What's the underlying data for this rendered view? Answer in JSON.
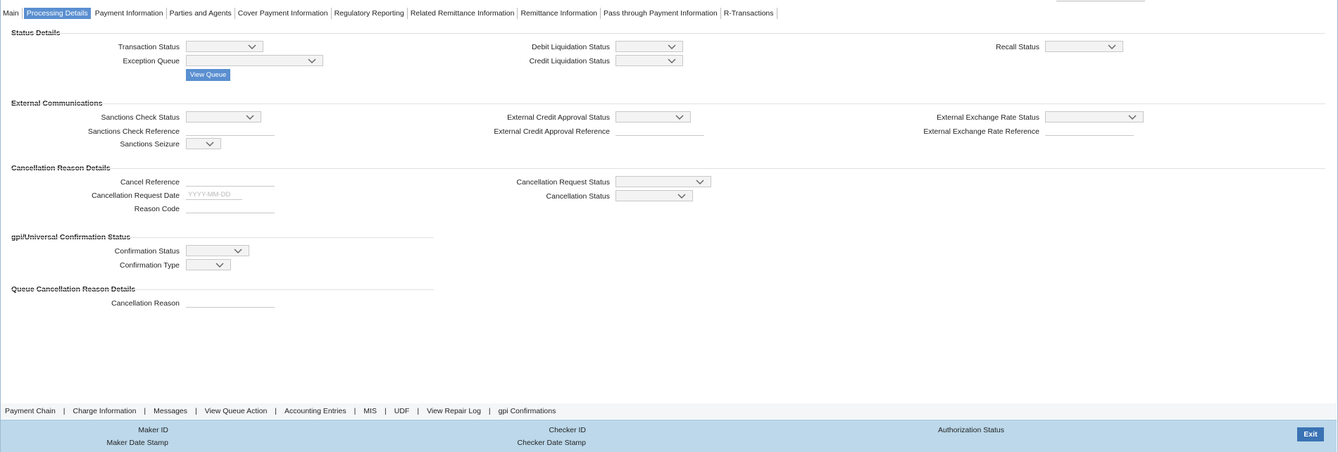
{
  "tabs": [
    {
      "label": "Main"
    },
    {
      "label": "Processing Details",
      "active": true
    },
    {
      "label": "Payment Information"
    },
    {
      "label": "Parties and Agents"
    },
    {
      "label": "Cover Payment Information"
    },
    {
      "label": "Regulatory Reporting"
    },
    {
      "label": "Related Remittance Information"
    },
    {
      "label": "Remittance Information"
    },
    {
      "label": "Pass through Payment Information"
    },
    {
      "label": "R-Transactions"
    }
  ],
  "status_details": {
    "title": "Status Details",
    "transaction_status": "Transaction Status",
    "exception_queue": "Exception Queue",
    "view_queue": "View Queue",
    "debit_liquidation_status": "Debit Liquidation Status",
    "credit_liquidation_status": "Credit Liquidation Status",
    "recall_status": "Recall Status"
  },
  "external_communications": {
    "title": "External Communications",
    "sanctions_check_status": "Sanctions Check Status",
    "sanctions_check_reference": "Sanctions Check Reference",
    "sanctions_seizure": "Sanctions Seizure",
    "external_credit_approval_status": "External Credit Approval Status",
    "external_credit_approval_reference": "External Credit Approval Reference",
    "external_exchange_rate_status": "External Exchange Rate Status",
    "external_exchange_rate_reference": "External Exchange Rate Reference"
  },
  "cancellation_reason_details": {
    "title": "Cancellation Reason Details",
    "cancel_reference": "Cancel Reference",
    "cancellation_request_date": "Cancellation Request Date",
    "date_placeholder": "YYYY-MM-DD",
    "reason_code": "Reason Code",
    "cancellation_request_status": "Cancellation Request Status",
    "cancellation_status": "Cancellation Status"
  },
  "gpi_confirmation": {
    "title": "gpi/Universal Confirmation Status",
    "confirmation_status": "Confirmation Status",
    "confirmation_type": "Confirmation Type"
  },
  "queue_cancellation": {
    "title": "Queue Cancellation Reason Details",
    "cancellation_reason": "Cancellation Reason"
  },
  "bottom_links": [
    {
      "label": "Payment Chain"
    },
    {
      "label": "Charge Information"
    },
    {
      "label": "Messages"
    },
    {
      "label": "View Queue Action"
    },
    {
      "label": "Accounting Entries"
    },
    {
      "label": "MIS"
    },
    {
      "label": "UDF"
    },
    {
      "label": "View Repair Log"
    },
    {
      "label": "gpi Confirmations"
    }
  ],
  "link_separator": "|",
  "footer": {
    "maker_id": "Maker ID",
    "maker_date_stamp": "Maker Date Stamp",
    "checker_id": "Checker ID",
    "checker_date_stamp": "Checker Date Stamp",
    "authorization_status": "Authorization Status",
    "exit": "Exit"
  },
  "colors": {
    "accent": "#5a8fd0",
    "footer_bg": "#bcd8ea",
    "exit_button": "#3a73b4"
  }
}
